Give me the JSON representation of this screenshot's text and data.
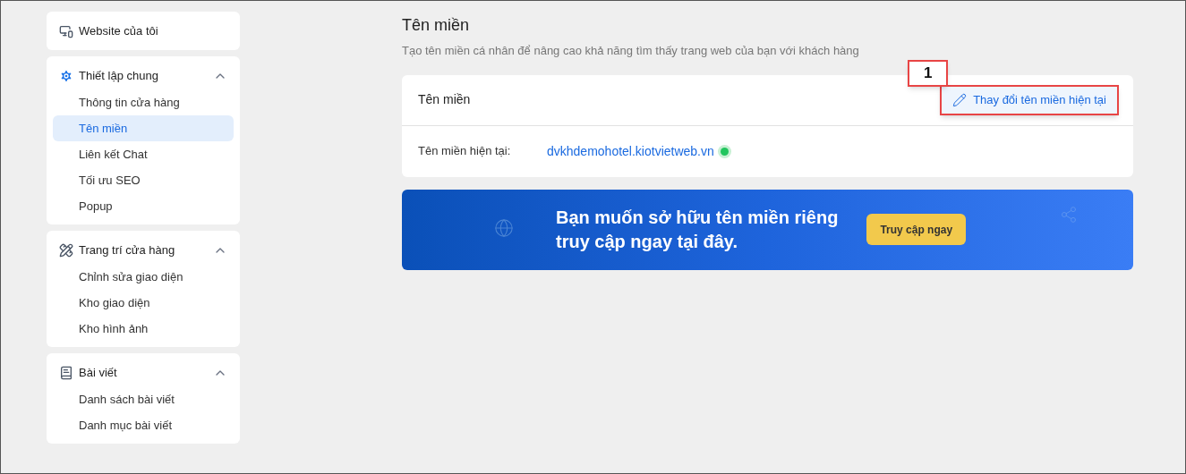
{
  "sidebar": {
    "groups": [
      {
        "kind": "link",
        "title": "Website của tôi"
      },
      {
        "kind": "section",
        "title": "Thiết lập chung",
        "expanded": true,
        "items": [
          {
            "label": "Thông tin cửa hàng",
            "selected": false
          },
          {
            "label": "Tên miền",
            "selected": true
          },
          {
            "label": "Liên kết Chat",
            "selected": false
          },
          {
            "label": "Tối ưu SEO",
            "selected": false
          },
          {
            "label": "Popup",
            "selected": false
          }
        ]
      },
      {
        "kind": "section",
        "title": "Trang trí cửa hàng",
        "expanded": true,
        "items": [
          {
            "label": "Chỉnh sửa giao diện",
            "selected": false
          },
          {
            "label": "Kho giao diện",
            "selected": false
          },
          {
            "label": "Kho hình ảnh",
            "selected": false
          }
        ]
      },
      {
        "kind": "section",
        "title": "Bài viết",
        "expanded": true,
        "items": [
          {
            "label": "Danh sách bài viết",
            "selected": false
          },
          {
            "label": "Danh mục bài viết",
            "selected": false
          }
        ]
      }
    ]
  },
  "page": {
    "title": "Tên miền",
    "subtitle": "Tạo tên miền cá nhân để nâng cao khả năng tìm thấy trang web của bạn với khách hàng"
  },
  "card": {
    "title": "Tên miền",
    "action": "Thay đổi tên miền hiện tại",
    "annotation": "1",
    "field_label": "Tên miền hiện tại:",
    "domain": "dvkhdemohotel.kiotvietweb.vn",
    "active": true
  },
  "banner": {
    "lines": [
      "Bạn muốn sở hữu tên miền riêng",
      "truy cập ngay tại đây."
    ],
    "button": "Truy cập ngay"
  }
}
